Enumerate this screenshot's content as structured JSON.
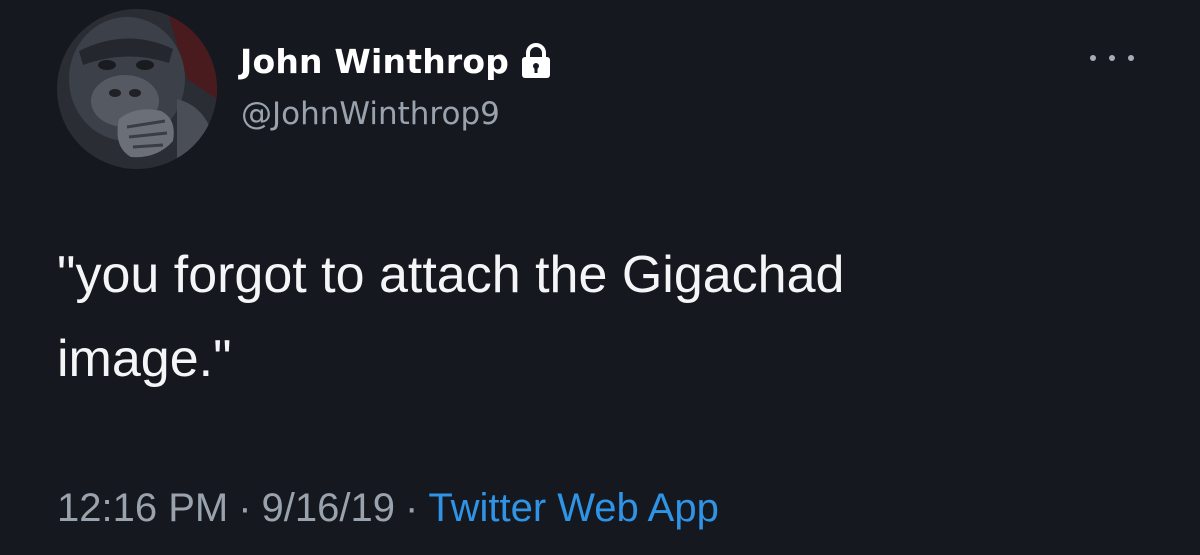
{
  "user": {
    "display_name": "John Winthrop",
    "handle": "@JohnWinthrop9",
    "avatar_icon": "gorilla-avatar",
    "protected_icon": "lock-icon"
  },
  "tweet": {
    "text_line1": "\"you forgot to attach the Gigachad",
    "text_line2": "image.\""
  },
  "meta": {
    "time": "12:16 PM",
    "separator": "·",
    "date": "9/16/19",
    "source": "Twitter Web App"
  },
  "menu": {
    "more_icon": "ellipsis-icon"
  },
  "colors": {
    "background": "#15181f",
    "text": "#f4f5f7",
    "secondary": "#9aa3ad",
    "link": "#2f93e6"
  }
}
